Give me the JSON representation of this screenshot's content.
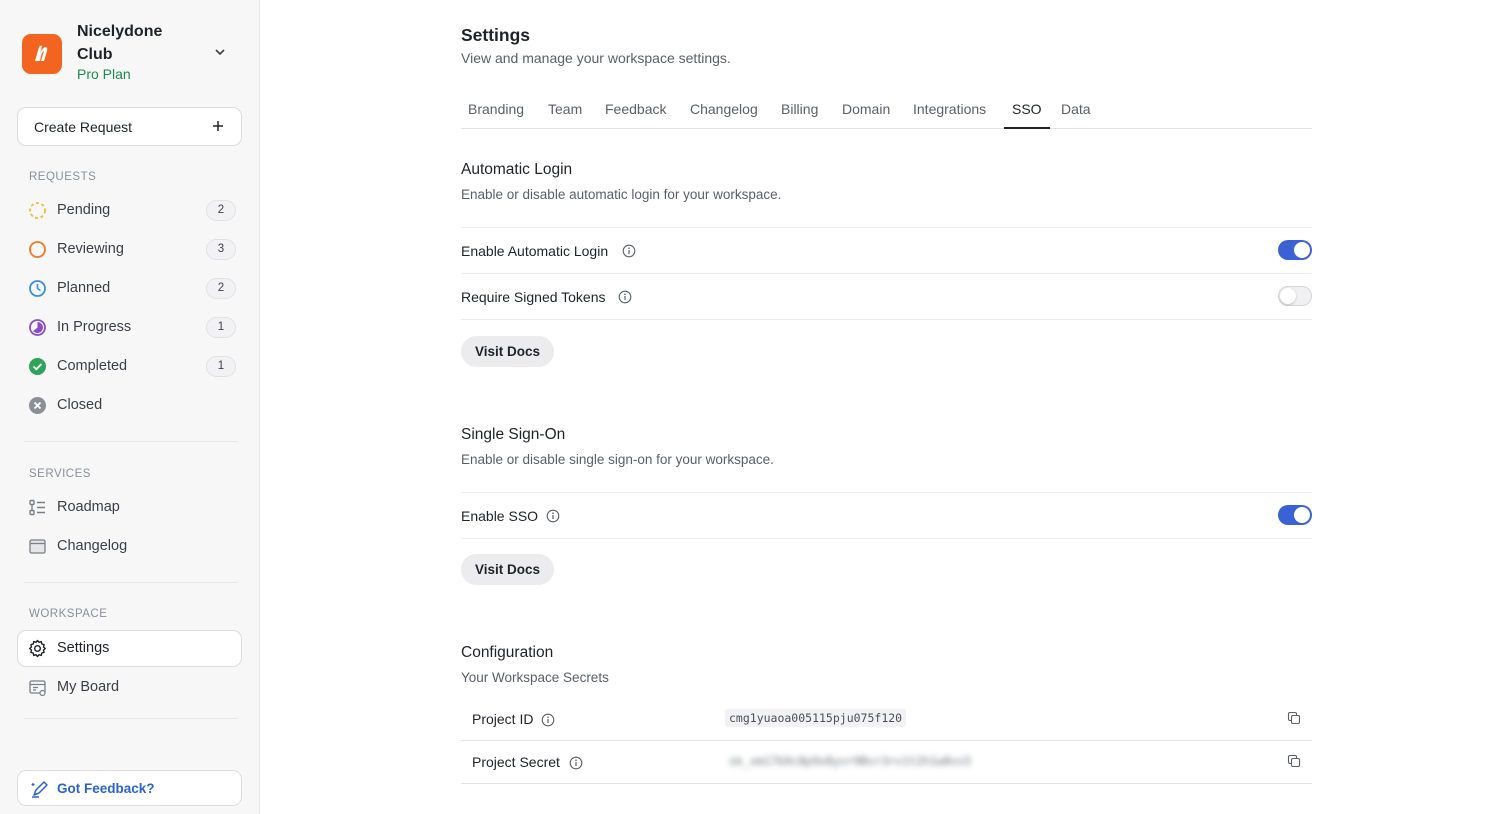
{
  "workspace": {
    "name": "Nicelydone Club",
    "plan": "Pro Plan"
  },
  "sidebar": {
    "create_label": "Create Request",
    "requests_title": "REQUESTS",
    "requests": [
      {
        "label": "Pending",
        "count": "2",
        "icon": "pending-icon"
      },
      {
        "label": "Reviewing",
        "count": "3",
        "icon": "reviewing-icon"
      },
      {
        "label": "Planned",
        "count": "2",
        "icon": "planned-icon"
      },
      {
        "label": "In Progress",
        "count": "1",
        "icon": "in-progress-icon"
      },
      {
        "label": "Completed",
        "count": "1",
        "icon": "completed-icon"
      },
      {
        "label": "Closed",
        "icon": "closed-icon"
      }
    ],
    "services_title": "SERVICES",
    "services": [
      {
        "label": "Roadmap",
        "icon": "roadmap-icon"
      },
      {
        "label": "Changelog",
        "icon": "changelog-icon"
      }
    ],
    "workspace_title": "WORKSPACE",
    "workspace_items": [
      {
        "label": "Settings",
        "icon": "gear-icon",
        "active": true
      },
      {
        "label": "My Board",
        "icon": "board-icon"
      }
    ],
    "feedback_label": "Got Feedback?"
  },
  "header": {
    "title": "Settings",
    "subtitle": "View and manage your workspace settings."
  },
  "tabs": [
    "Branding",
    "Team",
    "Feedback",
    "Changelog",
    "Billing",
    "Domain",
    "Integrations",
    "SSO",
    "Data"
  ],
  "active_tab": "SSO",
  "automatic_login": {
    "title": "Automatic Login",
    "subtitle": "Enable or disable automatic login for your workspace.",
    "rows": [
      {
        "label": "Enable Automatic Login",
        "enabled": true
      },
      {
        "label": "Require Signed Tokens",
        "enabled": false
      }
    ],
    "docs_label": "Visit Docs"
  },
  "sso": {
    "title": "Single Sign-On",
    "subtitle": "Enable or disable single sign-on for your workspace.",
    "rows": [
      {
        "label": "Enable SSO",
        "enabled": true
      }
    ],
    "docs_label": "Visit Docs"
  },
  "configuration": {
    "title": "Configuration",
    "subtitle": "Your Workspace Secrets",
    "project_id_label": "Project ID",
    "project_id_value": "cmg1yuaoa005115pju075f120",
    "project_secret_label": "Project Secret",
    "project_secret_value": "sk_xm17b9c8p9x8yvr9Bvr3rv1t2h1w8vs5"
  },
  "colors": {
    "accent": "#3b62d4",
    "brand": "#f2641f",
    "plan": "#1e8a4c"
  }
}
